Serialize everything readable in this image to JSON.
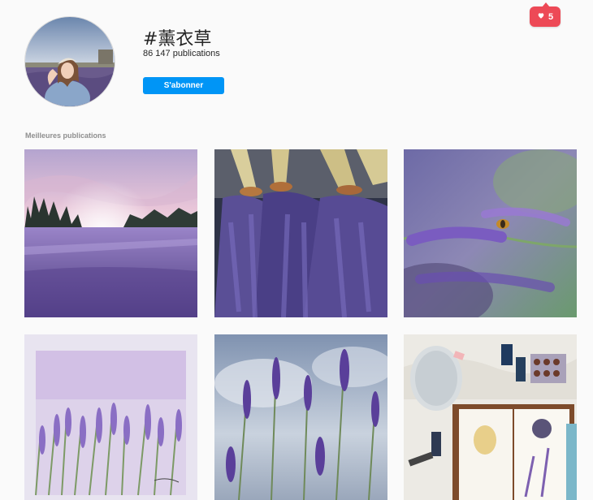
{
  "notification": {
    "count": "5",
    "icon": "heart-icon",
    "color": "#ed4956"
  },
  "profile": {
    "hashtag": "#薰衣草",
    "post_count": "86 147 publications",
    "follow_label": "S'abonner",
    "button_color": "#0095f6"
  },
  "top_posts": {
    "section_label": "Meilleures publications",
    "tiles": [
      "lavender field at sunset",
      "lavender bundles",
      "lavender with bee",
      "lavender watercolor painting",
      "lavender against cloudy sky",
      "journal with lavender oils"
    ]
  }
}
